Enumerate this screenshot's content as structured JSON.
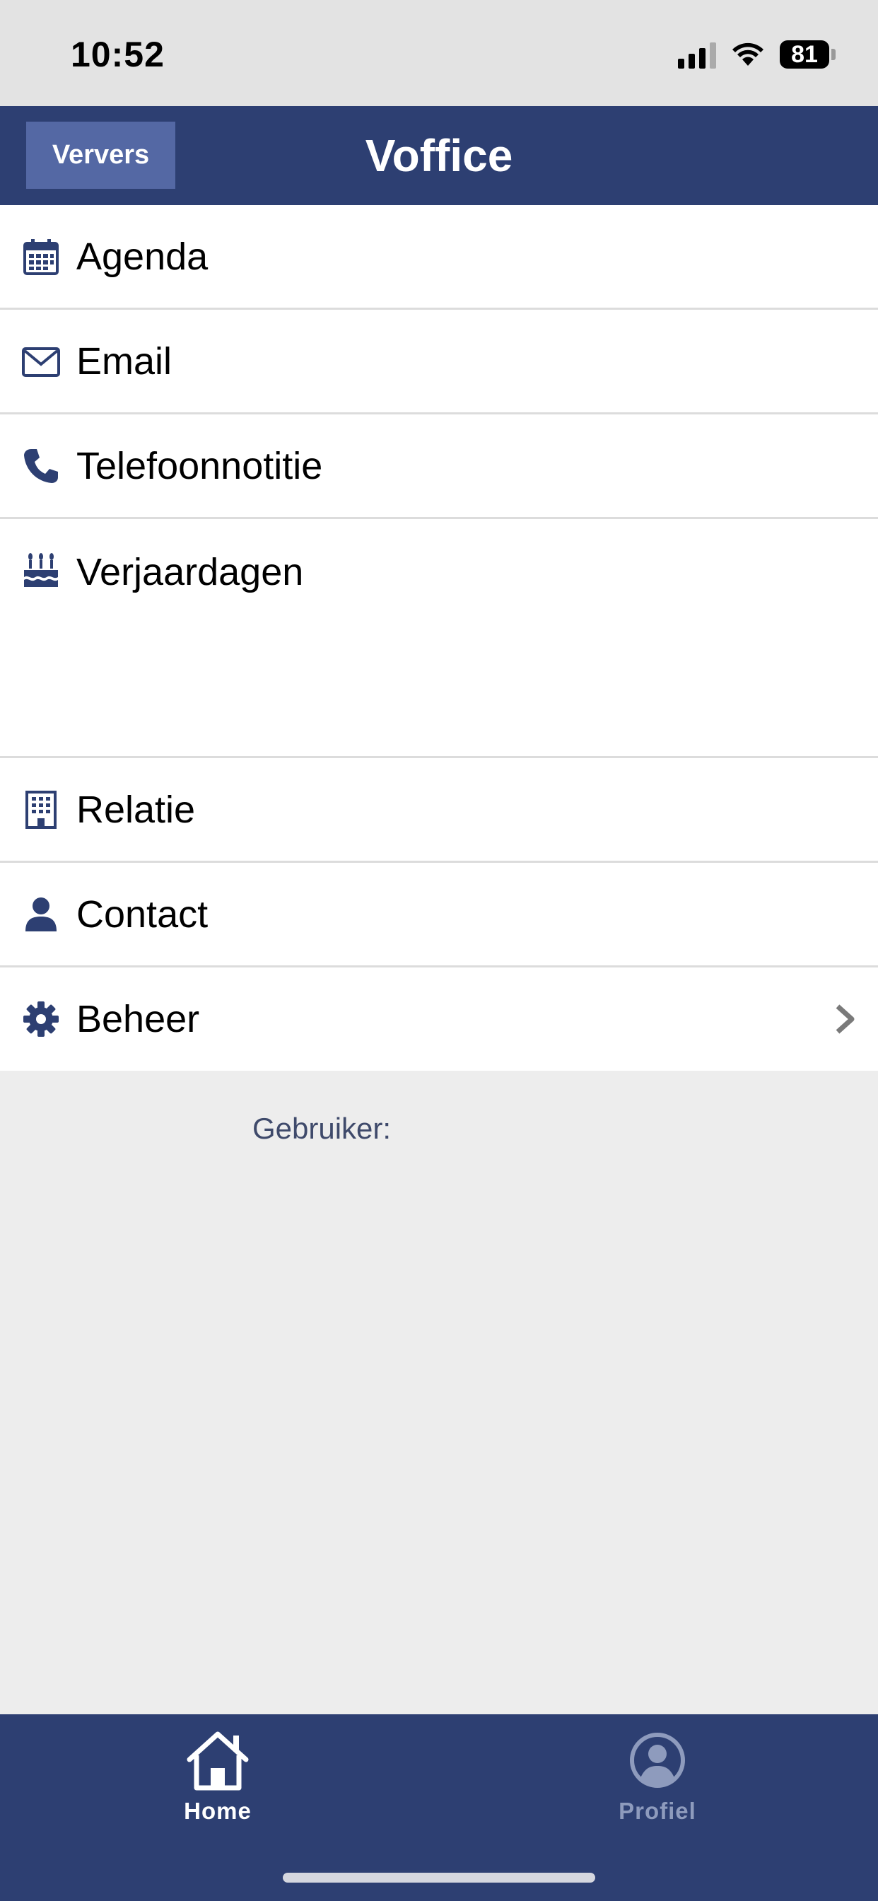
{
  "status": {
    "time": "10:52",
    "battery": "81"
  },
  "header": {
    "refresh_label": "Ververs",
    "title": "Voffice"
  },
  "menu": [
    {
      "label": "Agenda",
      "icon": "calendar-icon"
    },
    {
      "label": "Email",
      "icon": "envelope-icon"
    },
    {
      "label": "Telefoonnotitie",
      "icon": "phone-icon"
    },
    {
      "label": "Verjaardagen",
      "icon": "birthday-cake-icon"
    },
    {
      "label": "Relatie",
      "icon": "building-icon"
    },
    {
      "label": "Contact",
      "icon": "user-icon"
    },
    {
      "label": "Beheer",
      "icon": "gear-icon"
    }
  ],
  "user_label": "Gebruiker:",
  "tabs": [
    {
      "label": "Home",
      "icon": "home-icon",
      "active": true
    },
    {
      "label": "Profiel",
      "icon": "profile-icon",
      "active": false
    }
  ],
  "colors": {
    "brand": "#2d3f72",
    "button": "#5468a4",
    "background": "#ededed"
  }
}
